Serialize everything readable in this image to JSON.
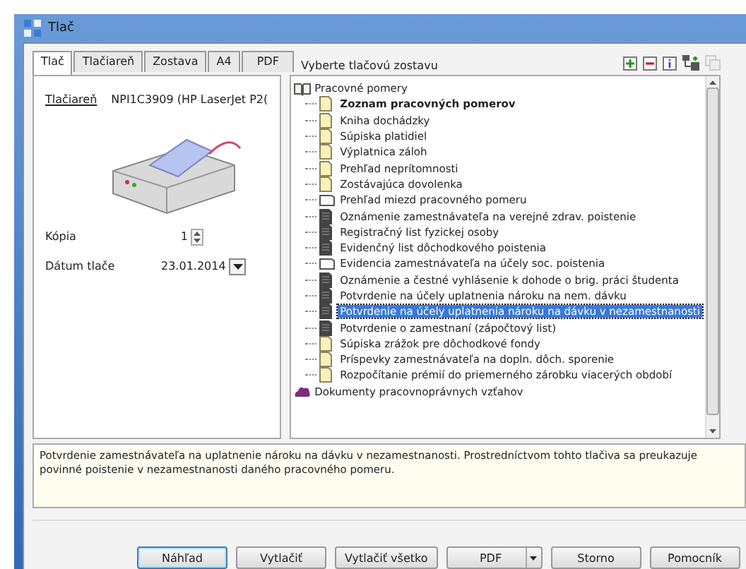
{
  "window": {
    "title": "Tlač"
  },
  "tabs": [
    {
      "label": "Tlač",
      "selected": true
    },
    {
      "label": "Tlačiareň",
      "selected": false
    },
    {
      "label": "Zostava",
      "selected": false
    },
    {
      "label": "A4",
      "selected": false
    },
    {
      "label": "PDF",
      "selected": false
    }
  ],
  "report_heading": "Vyberte tlačovú zostavu",
  "printer": {
    "link": "Tlačiareň",
    "name": "NPI1C3909 (HP LaserJet P2("
  },
  "copies": {
    "label": "Kópia",
    "value": "1"
  },
  "print_date": {
    "label": "Dátum tlače",
    "value": "23.01.2014"
  },
  "tree": [
    {
      "label": "Pracovné pomery",
      "kind": "book",
      "bold": false,
      "selected": false,
      "children": [
        {
          "label": "Zoznam pracovných pomerov",
          "kind": "note",
          "bold": true,
          "selected": false
        },
        {
          "label": "Kniha dochádzky",
          "kind": "note",
          "bold": false,
          "selected": false
        },
        {
          "label": "Súpiska platidiel",
          "kind": "note",
          "bold": false,
          "selected": false
        },
        {
          "label": "Výplatnica záloh",
          "kind": "note",
          "bold": false,
          "selected": false
        },
        {
          "label": "Prehľad neprítomnosti",
          "kind": "note",
          "bold": false,
          "selected": false
        },
        {
          "label": "Zostávajúca dovolenka",
          "kind": "note",
          "bold": false,
          "selected": false
        },
        {
          "label": "Prehľad miezd pracovného pomeru",
          "kind": "page",
          "bold": false,
          "selected": false
        },
        {
          "label": "Oznámenie zamestnávateľa na verejné zdrav. poistenie",
          "kind": "form",
          "bold": false,
          "selected": false
        },
        {
          "label": "Registračný list fyzickej osoby",
          "kind": "form",
          "bold": false,
          "selected": false
        },
        {
          "label": "Evidenčný list dôchodkového poistenia",
          "kind": "form",
          "bold": false,
          "selected": false
        },
        {
          "label": "Evidencia zamestnávateľa na účely soc. poistenia",
          "kind": "page",
          "bold": false,
          "selected": false
        },
        {
          "label": "Oznámenie a čestné vyhlásenie k dohode o brig. práci študenta",
          "kind": "form",
          "bold": false,
          "selected": false
        },
        {
          "label": "Potvrdenie na účely uplatnenia nároku na nem. dávku",
          "kind": "form",
          "bold": false,
          "selected": false
        },
        {
          "label": "Potvrdenie na účely uplatnenia nároku na dávku v nezamestnanosti",
          "kind": "form",
          "bold": false,
          "selected": true
        },
        {
          "label": "Potvrdenie o zamestnaní (zápočtový list)",
          "kind": "form",
          "bold": false,
          "selected": false
        },
        {
          "label": "Súpiska zrážok pre dôchodkové fondy",
          "kind": "note",
          "bold": false,
          "selected": false
        },
        {
          "label": "Príspevky zamestnávateľa na dopln. dôch. sporenie",
          "kind": "note",
          "bold": false,
          "selected": false
        },
        {
          "label": "Rozpočítanie prémií do priemerného zárobku viacerých období",
          "kind": "note",
          "bold": false,
          "selected": false
        }
      ]
    },
    {
      "label": "Dokumenty pracovnoprávnych vzťahov",
      "kind": "cloud",
      "bold": false,
      "selected": false
    }
  ],
  "description": "Potvrdenie zamestnávateľa na uplatnenie nároku na dávku v nezamestnanosti. Prostredníctvom tohto tlačiva sa preukazuje povinné poistenie v nezamestnanosti daného pracovného pomeru.",
  "buttons": [
    {
      "label": "Náhľad",
      "kind": "default"
    },
    {
      "label": "Vytlačiť",
      "kind": "plain"
    },
    {
      "label": "Vytlačiť všetko",
      "kind": "plain"
    },
    {
      "label": "PDF",
      "kind": "split"
    },
    {
      "label": "Storno",
      "kind": "plain"
    },
    {
      "label": "Pomocník",
      "kind": "plain"
    }
  ]
}
